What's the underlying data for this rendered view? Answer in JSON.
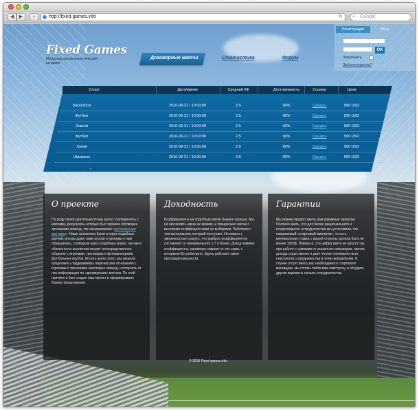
{
  "browser": {
    "url": "http://fixed-games.info",
    "search_placeholder": "Google",
    "back_icon": "◀",
    "forward_icon": "▶",
    "add_icon": "+",
    "reload_icon": "↻",
    "search_icon": "⌕"
  },
  "site": {
    "logo": "Fixed Games",
    "tagline": "Международный аналитический синдикат",
    "nav": [
      {
        "label": "Договорные матчи",
        "active": true
      },
      {
        "label": "Статистика",
        "active": false
      },
      {
        "label": "Форум",
        "active": false
      }
    ],
    "login": {
      "tab_register": "Регистрация",
      "tab_login": "Вход",
      "ok_label": "OK",
      "remember_label": "Запомнить",
      "forgot_label": "Забыли пароль?"
    },
    "table": {
      "headers": [
        "Спорт",
        "Дата/время",
        "Средний КФ",
        "Достоверность",
        "Ссылка",
        "Цена"
      ],
      "rows": [
        [
          "Баскетбол",
          "2010-09-21 / 10:00:00",
          "2.5",
          "90%",
          "Скачать",
          "500 USD"
        ],
        [
          "Футбол",
          "2010-09-21 / 10:00:00",
          "2.5",
          "90%",
          "Скачать",
          "500 USD"
        ],
        [
          "Хоккей",
          "2010-09-21 / 10:00:00",
          "2.5",
          "90%",
          "Скачать",
          "500 USD"
        ],
        [
          "Футбол",
          "2010-09-21 / 10:00:00",
          "2.5",
          "90%",
          "Скачать",
          "500 USD"
        ],
        [
          "Хокей",
          "2010-09-21 / 10:00:00",
          "2.5",
          "90%",
          "Скачать",
          "500 USD"
        ],
        [
          "Шахматы",
          "2010-09-21 / 10:00:00",
          "2.5",
          "90%",
          "Скачать",
          "500 USD"
        ]
      ],
      "more_icon": "⌄"
    },
    "panels": [
      {
        "title": "О проекте",
        "text_before": "По роду своей деятельности мы много сталкивались с матчами, результаты которых был заранее обговорен тренерами команд, так называемыми «",
        "link": "договорными матчами",
        "text_after": "». Наши аналитики были в курсе подобных матчей, иногда даже сами игроки и тренеры к нам обращались, сообщали нам о подобных играх, так как в обязанности аналитика входит непосредственное общение с игроками, тренерами и функционерами футбольных клубов. Вплоть всего этого, мы решили продолжить поддерживать партнерские отношения с игроками и тренерами некоторых команд, и получать от них информацию по «договорным» матчам. По этой причине и был создан наш проект и сформировано бизнес-предложение."
      },
      {
        "title": "Доходность",
        "text": "Коэффициенты на подобные матчи бывают разные. Мы на них влиять никак не можем, и специально матчи с высокими коэффициентами не выбираем. Работаем с тем материалом, который поступает. Но можно с уверенностью сказать, что разброс коэффициентов составляет от минимального 1.7 и более. Доход помимо коэффициента, напрямую зависит от тех сумм, с которыми Вы работаете. Здесь работает закон пропорциональности."
      },
      {
        "title": "Гарантии",
        "text": "Мы можем предоставить вам разумные гарантии. Полезно знать, что для более рационального и плодотворного сотрудничества мы установили, так называемый «стартовый минимум», то есть минимальная ставка с вашей стороны должна быть не менее 1000$. Поверьте, эта цифра взята не просто так, при работе с суммами от указанного минимума, приток дохода существенен и дает четкое понимание всех перспектив сотрудничества в этом направлении. В случае отсутствия у вас необходимого стартового минимума, мы готовы пойти вам навстречу, и обсудить другие варианты начала сотрудничества."
      }
    ],
    "copyright": "© 2010 Fixed-games.info"
  }
}
